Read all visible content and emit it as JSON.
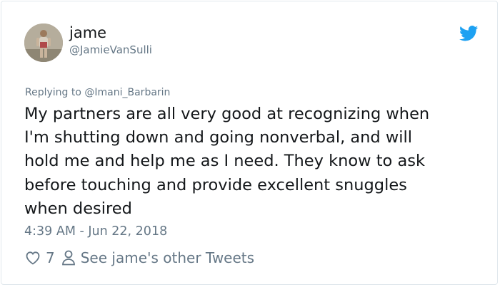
{
  "tweet": {
    "display_name": "jame",
    "handle": "@JamieVanSulli",
    "reply_prefix": "Replying to ",
    "reply_to": "@Imani_Barbarin",
    "text": "My partners are all very good at recognizing when\nI'm shutting down and going nonverbal, and will\nhold me and help me as I need. They know to ask\nbefore touching and provide excellent snuggles\nwhen desired",
    "timestamp": "4:39 AM - Jun 22, 2018",
    "like_count": "7",
    "other_tweets_label": "See jame's other Tweets"
  },
  "icons": {
    "brand": "twitter-bird-icon",
    "like": "heart-icon",
    "profile": "person-icon"
  },
  "colors": {
    "twitter_blue": "#1da1f2",
    "secondary_text": "#657786",
    "primary_text": "#14171a",
    "border": "#e1e8ed"
  }
}
